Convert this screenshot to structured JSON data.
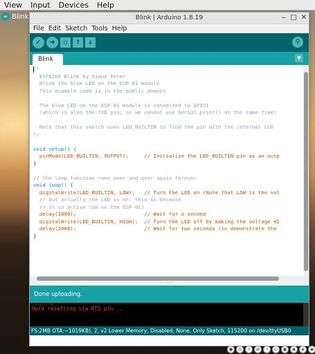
{
  "system_menu": [
    "View",
    "Input",
    "Devices",
    "Help"
  ],
  "taskbar": {
    "label": "Blink",
    "icon": "arduino-icon"
  },
  "window": {
    "title": "Blink | Arduino 1.8.19",
    "controls": [
      "‒",
      "□",
      "✕"
    ]
  },
  "menu": [
    "File",
    "Edit",
    "Sketch",
    "Tools",
    "Help"
  ],
  "toolbar": {
    "buttons": [
      "verify-icon",
      "upload-icon",
      "new-icon",
      "open-icon",
      "save-icon"
    ],
    "serial_monitor": "serial-monitor-icon",
    "accent": "#006468",
    "button_color": "#4db7bb"
  },
  "tabs": {
    "active": "Blink",
    "menu_icon": "tab-menu-icon"
  },
  "code_lines": [
    "/*",
    "  ESP8266 Blink by Simon Peter",
    "  Blink the blue LED on the ESP-01 module",
    "  This example code is in the public domain",
    "",
    "  The blue LED on the ESP-01 module is connected to GPIO1",
    "  (which is also the TXD pin; so we cannot use Serial.print() at the same time)",
    "",
    "  Note that this sketch uses LED_BUILTIN to find the pin with the internal LED",
    "*/",
    "",
    "void setup() {",
    "  pinMode(LED_BUILTIN, OUTPUT);     // Initialize the LED_BUILTIN pin as an outp",
    "}",
    "",
    "// the loop function runs over and over again forever",
    "void loop() {",
    "  digitalWrite(LED_BUILTIN, LOW);   // Turn the LED on (Note that LOW is the vol",
    "  // but actually the LED is on; this is because",
    "  // it is active low on the ESP-01)",
    "  delay(1000);                      // Wait for a second",
    "  digitalWrite(LED_BUILTIN, HIGH);  // Turn the LED off by making the voltage HI",
    "  delay(2000);                      // Wait for two seconds (to demonstrate the",
    "}"
  ],
  "status": "Done uploading.",
  "console": {
    "cut_line": "Leaving...",
    "line": "Hard resetting via RTS pin..."
  },
  "board_info": "FS:2MB OTA:~1019KB), 2, v2 Lower Memory, Disabled, None, Only Sketch, 115200 on /dev/ttyUSB0"
}
